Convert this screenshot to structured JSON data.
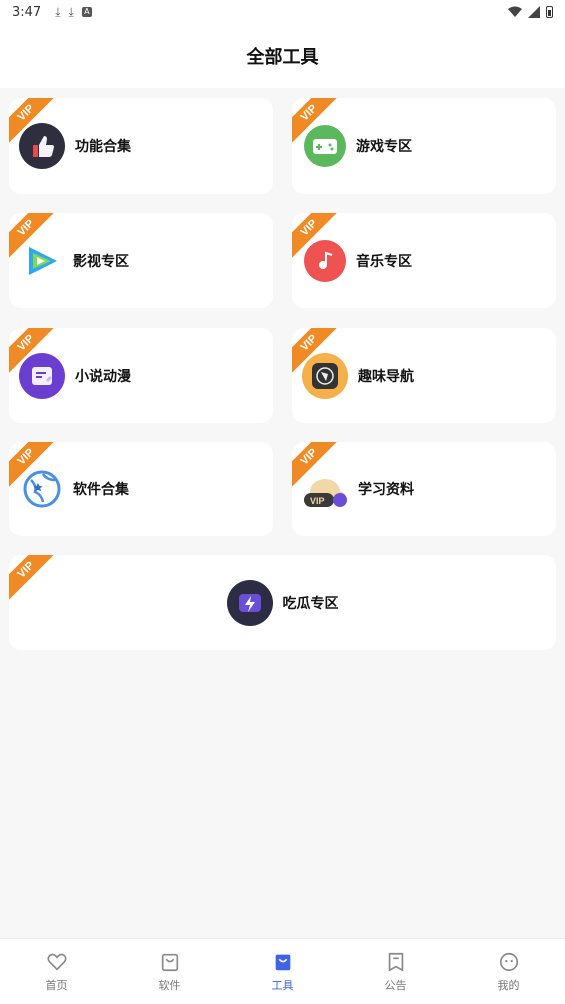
{
  "status_bar": {
    "time": "3:47",
    "left_icons": [
      "download-icon",
      "download-icon",
      "a-icon"
    ],
    "right_icons": [
      "wifi-icon",
      "signal-icon",
      "battery-icon"
    ]
  },
  "header": {
    "title": "全部工具"
  },
  "badge": {
    "vip_text": "VIP",
    "color": "#f08a24"
  },
  "tools": [
    {
      "label": "功能合集",
      "icon": "thumbs-up-icon"
    },
    {
      "label": "游戏专区",
      "icon": "gamepad-icon"
    },
    {
      "label": "影视专区",
      "icon": "video-play-icon"
    },
    {
      "label": "音乐专区",
      "icon": "music-note-icon"
    },
    {
      "label": "小说动漫",
      "icon": "book-icon"
    },
    {
      "label": "趣味导航",
      "icon": "compass-icon"
    },
    {
      "label": "软件合集",
      "icon": "globe-icon"
    },
    {
      "label": "学习资料",
      "icon": "vip-cloud-icon"
    },
    {
      "label": "吃瓜专区",
      "icon": "lightning-icon"
    }
  ],
  "bottom_nav": [
    {
      "label": "首页",
      "icon": "heart-icon",
      "active": false
    },
    {
      "label": "软件",
      "icon": "bag-icon",
      "active": false
    },
    {
      "label": "工具",
      "icon": "bag-icon",
      "active": true
    },
    {
      "label": "公告",
      "icon": "bookmark-icon",
      "active": false
    },
    {
      "label": "我的",
      "icon": "smile-icon",
      "active": false
    }
  ],
  "colors": {
    "accent": "#3f63e6",
    "vip_badge": "#f08a24",
    "background": "#f7f7f7"
  }
}
